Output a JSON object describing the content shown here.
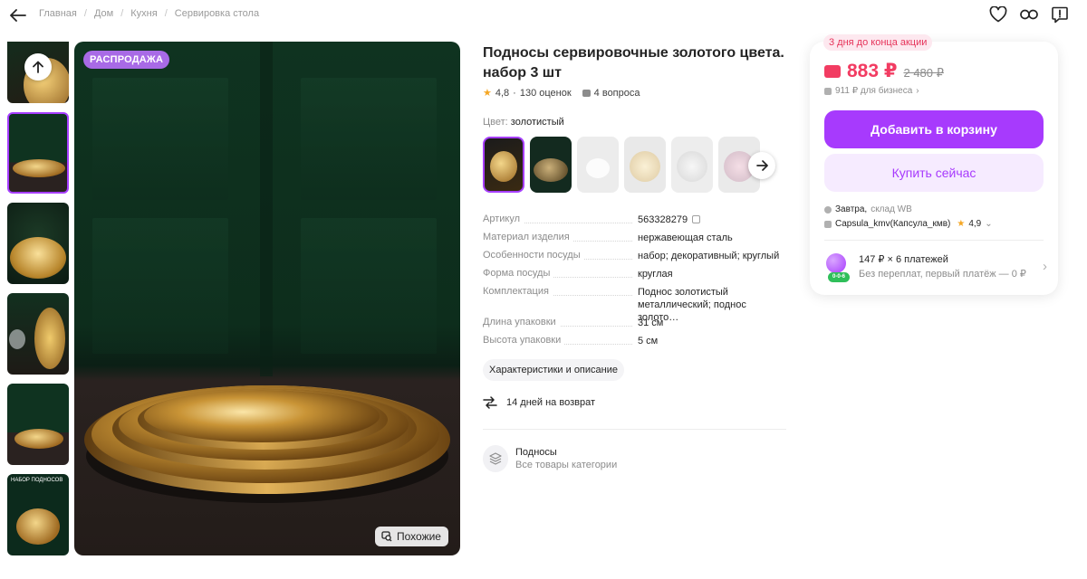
{
  "breadcrumbs": [
    "Главная",
    "Дом",
    "Кухня",
    "Сервировка стола"
  ],
  "top_icons": [
    "heart-icon",
    "link-icon",
    "report-icon"
  ],
  "gallery": {
    "sale_badge": "РАСПРОДАЖА",
    "similar_label": "Похожие",
    "thumb_text": "НАБОР ПОДНОСОВ",
    "thumb_count": 6,
    "active_thumb": 2
  },
  "product": {
    "title": "Подносы сервировочные золотого цвета. набор 3 шт",
    "rating": "4,8",
    "reviews": "130 оценок",
    "questions": "4 вопроса",
    "color_label": "Цвет:",
    "color_value": "золотистый",
    "variant_count": 6,
    "specs": [
      {
        "key": "Артикул",
        "value": "563328279"
      },
      {
        "key": "Материал изделия",
        "value": "нержавеющая сталь"
      },
      {
        "key": "Особенности посуды",
        "value": "набор; декоративный; круглый"
      },
      {
        "key": "Форма посуды",
        "value": "круглая"
      },
      {
        "key": "Комплектация",
        "value": "Поднос золотистый металлический; поднос золото…"
      },
      {
        "key": "Длина упаковки",
        "value": "31 см"
      },
      {
        "key": "Высота упаковки",
        "value": "5 см"
      }
    ],
    "chars_button": "Характеристики и описание",
    "return_text": "14 дней на возврат",
    "category_name": "Подносы",
    "category_sub": "Все товары категории"
  },
  "buy": {
    "promo": "3 дня до конца акции",
    "price": "883 ₽",
    "old_price": "2 480 ₽",
    "business_price": "911 ₽ для бизнеса",
    "cart_button": "Добавить в корзину",
    "buy_button": "Купить сейчас",
    "delivery_day": "Завтра,",
    "delivery_warehouse": "склад WB",
    "seller": "Capsula_kmv(Капсула_кмв)",
    "seller_rating": "4,9",
    "installment_main": "147 ₽ × 6 платежей",
    "installment_sub": "Без переплат, первый платёж — 0 ₽",
    "installment_logo_text": "0-0-6"
  },
  "colors": {
    "accent": "#a73afd",
    "price": "#f23c62",
    "sale_badge": "#a86ae6"
  }
}
